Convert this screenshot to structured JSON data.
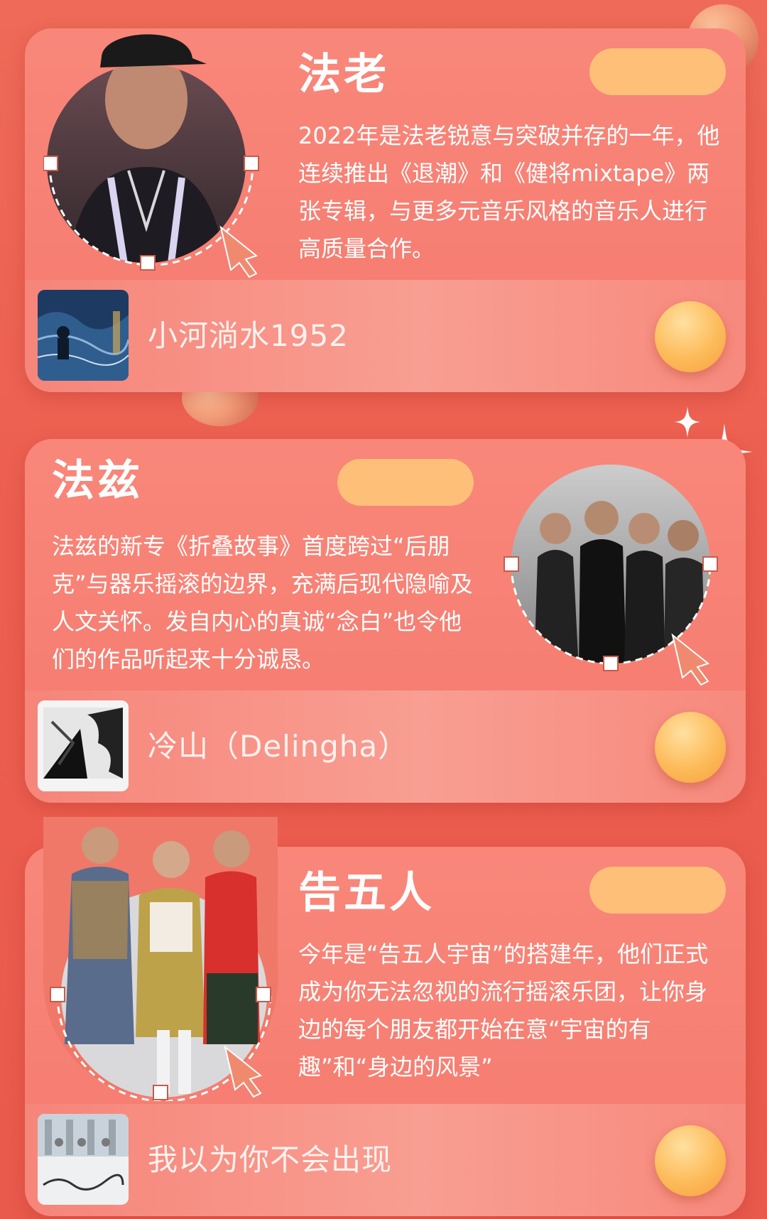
{
  "colors": {
    "background": "#ec5e4f",
    "card": "#f6806f",
    "pill": "#fec079",
    "play_button": "#fdbb5a",
    "text": "#ffffff"
  },
  "cards": [
    {
      "artist": "法老",
      "description": "2022年是法老锐意与突破并存的一年，他连续推出《退潮》和《健将mixtape》两张专辑，与更多元音乐风格的音乐人进行高质量合作。",
      "song": "小河淌水1952",
      "photo_icon": "artist-portrait-icon",
      "cover_icon": "album-cover-icon"
    },
    {
      "artist": "法兹",
      "description": "法兹的新专《折叠故事》首度跨过“后朋克”与器乐摇滚的边界，充满后现代隐喻及人文关怀。发自内心的真诚“念白”也令他们的作品听起来十分诚恳。",
      "song": "冷山（Delingha）",
      "photo_icon": "band-photo-icon",
      "cover_icon": "album-cover-icon"
    },
    {
      "artist": "告五人",
      "description": "今年是“告五人宇宙”的搭建年，他们正式成为你无法忽视的流行摇滚乐团，让你身边的每个朋友都开始在意“宇宙的有趣”和“身边的风景”",
      "song": "我以为你不会出现",
      "photo_icon": "band-photo-icon",
      "cover_icon": "album-cover-icon"
    }
  ]
}
